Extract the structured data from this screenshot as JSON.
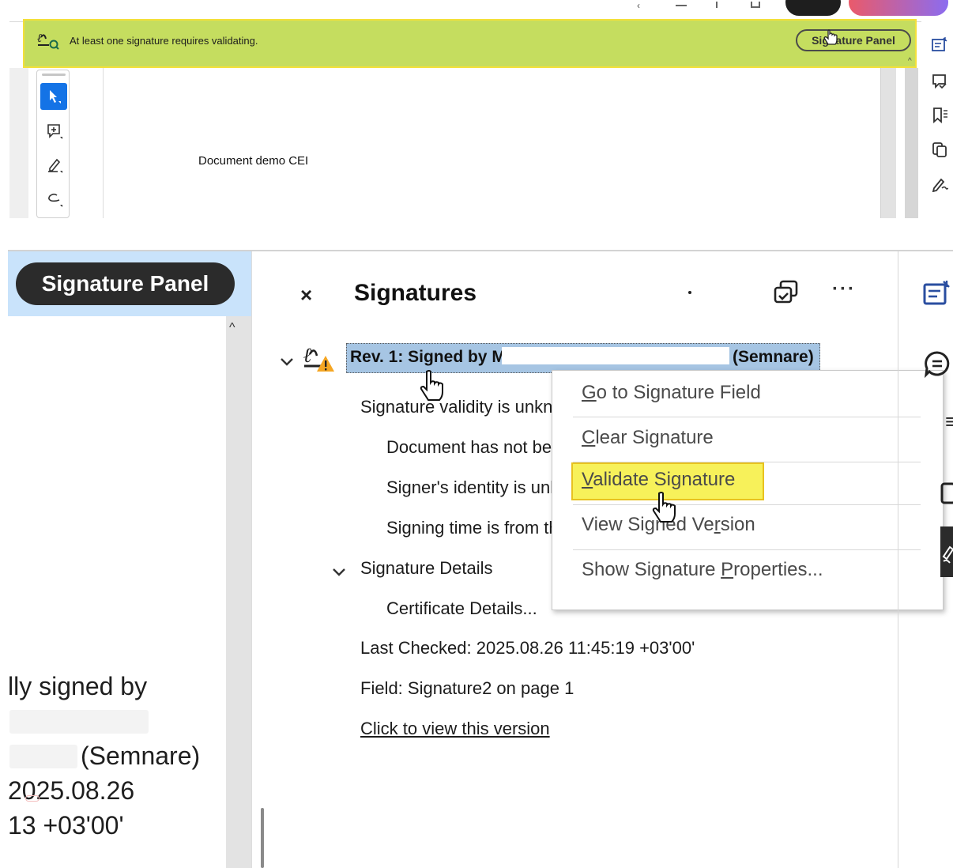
{
  "banner": {
    "message": "At least one signature requires validating.",
    "button_label": "Signature Panel"
  },
  "document": {
    "text": "Document demo CEI"
  },
  "left_pane": {
    "button_label": "Signature Panel",
    "lines": [
      "lly signed by",
      "(Semnare)",
      "2025.08.26",
      "13 +03'00'"
    ]
  },
  "signatures_panel": {
    "title": "Signatures",
    "close_glyph": "×",
    "more_glyph": "···",
    "revision": {
      "label_start": "Rev. 1: Signed by M.",
      "label_end": "(Semnare)"
    },
    "items": {
      "validity": "Signature validity is unkn",
      "not_modified": "Document has not be",
      "identity": "Signer's identity is unk",
      "signing_time": "Signing time is from th",
      "details": "Signature Details",
      "certificate": "Certificate Details...",
      "last_checked": "Last Checked: 2025.08.26 11:45:19 +03'00'",
      "field": "Field: Signature2 on page 1",
      "view_version": "Click to view this version"
    }
  },
  "context_menu": {
    "items": [
      {
        "label": "Go to Signature Field",
        "mnemonic": "G",
        "rest": "o to Signature Field"
      },
      {
        "label": "Clear Signature",
        "mnemonic": "C",
        "rest": "lear Signature"
      },
      {
        "label": "Validate Signature",
        "mnemonic": "V",
        "rest": "alidate Signature"
      },
      {
        "label": "View Signed Version",
        "pre": "View Signed Ve",
        "mnemonic": "r",
        "rest": "sion"
      },
      {
        "label": "Show Signature Properties...",
        "pre": "Show Signature ",
        "mnemonic": "P",
        "rest": "roperties..."
      }
    ],
    "highlighted": "Validate Signature"
  },
  "colors": {
    "banner_bg": "#c5dd5f",
    "highlight_border": "#f3e03a",
    "selected_tool": "#1473e6",
    "selection_row": "#a6c5e3",
    "menu_highlight": "#f7f15a",
    "left_pane_header": "#c9e3fb",
    "warning": "#f5a623"
  },
  "icons": {
    "banner": "signature-check-icon",
    "revision": "signature-warning-icon",
    "tools": [
      "select-arrow-icon",
      "add-comment-icon",
      "highlight-pen-icon",
      "lasso-draw-icon"
    ],
    "rail": [
      "fill-sign-icon",
      "comment-icon",
      "bookmark-icon",
      "pages-icon",
      "signature-pen-icon"
    ]
  }
}
